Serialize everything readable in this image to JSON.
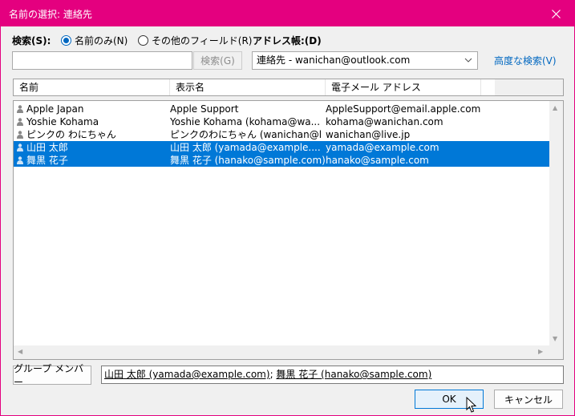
{
  "window": {
    "title": "名前の選択: 連絡先",
    "accent_color": "#e4007f",
    "close_icon": "close-icon"
  },
  "search": {
    "label": "検索(S):",
    "radio_name_only": "名前のみ(N)",
    "radio_other_fields": "その他のフィールド(R)",
    "selected_option": "名前のみ(N)",
    "input_value": "",
    "search_button": "検索(G)"
  },
  "address_book": {
    "label": "アドレス帳:(D)",
    "selected": "連絡先 - wanichan@outlook.com",
    "advanced_link": "高度な検索(V)"
  },
  "table": {
    "columns": [
      "名前",
      "表示名",
      "電子メール アドレス"
    ],
    "rows": [
      {
        "name": "Apple Japan",
        "display": "Apple Support",
        "email": "AppleSupport@email.apple.com",
        "selected": false
      },
      {
        "name": "Yoshie Kohama",
        "display": "Yoshie Kohama (kohama@wa...",
        "email": "kohama@wanichan.com",
        "selected": false
      },
      {
        "name": "ピンクの わにちゃん",
        "display": "ピンクのわにちゃん (wanichan@live...",
        "email": "wanichan@live.jp",
        "selected": false
      },
      {
        "name": "山田 太郎",
        "display": "山田 太郎 (yamada@example....",
        "email": "yamada@example.com",
        "selected": true
      },
      {
        "name": "舞黒 花子",
        "display": "舞黒 花子 (hanako@sample.com)",
        "email": "hanako@sample.com",
        "selected": true
      }
    ],
    "selection_color": "#0078d7"
  },
  "footer": {
    "group_button": "グループ メンバー",
    "recipient_1": "山田 太郎 (yamada@example.com)",
    "separator": "; ",
    "recipient_2": "舞黒 花子 (hanako@sample.com)",
    "ok_button": "OK",
    "cancel_button": "キャンセル"
  }
}
